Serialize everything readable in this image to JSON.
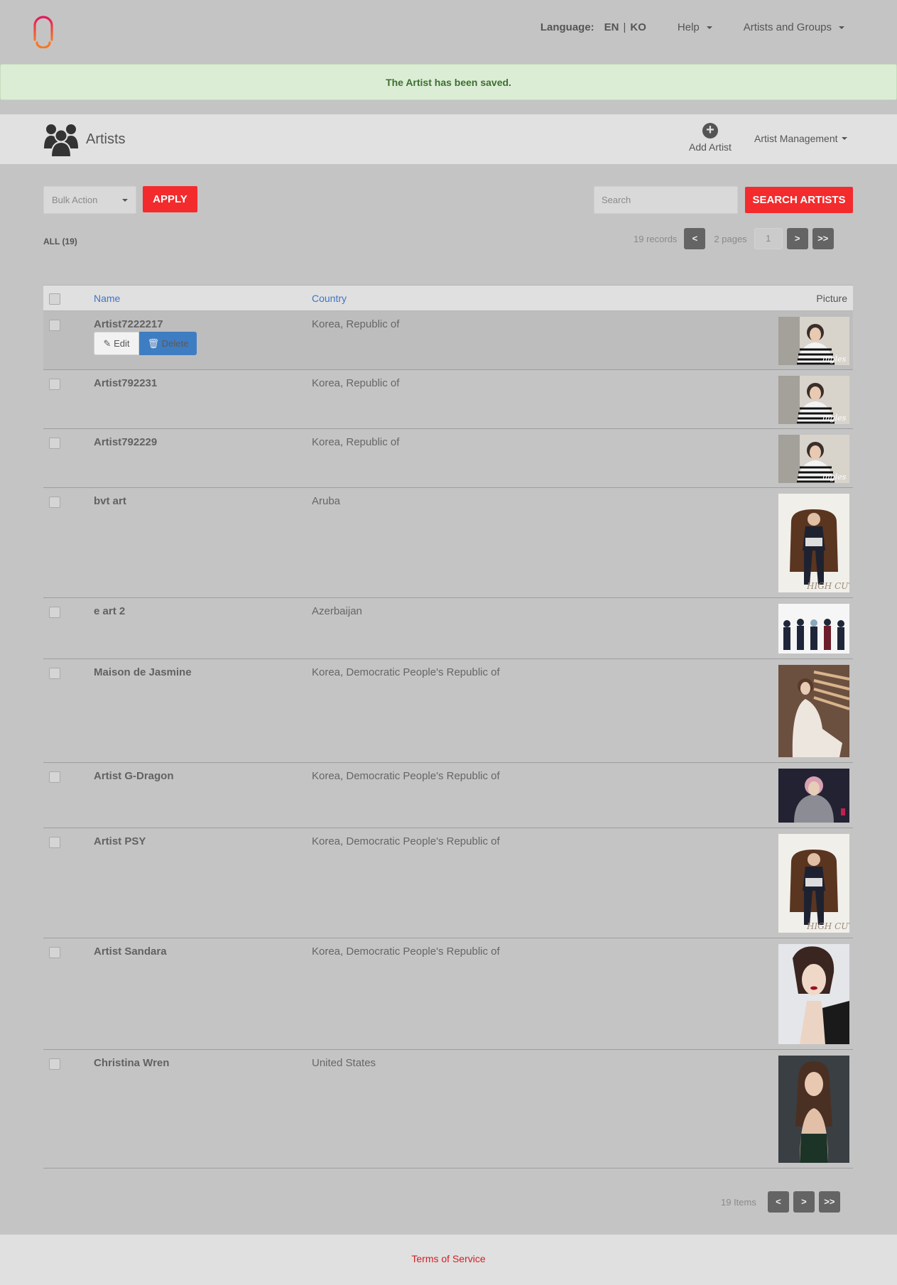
{
  "header": {
    "language_label": "Language:",
    "lang_en": "EN",
    "lang_sep": "|",
    "lang_ko": "KO",
    "help": "Help",
    "artists_groups": "Artists and Groups"
  },
  "alert": {
    "message": "The Artist has been saved."
  },
  "titlebar": {
    "title": "Artists",
    "add_artist": "Add Artist",
    "add_icon": "+",
    "artist_management": "Artist Management"
  },
  "controls": {
    "bulk_action": "Bulk Action",
    "apply": "APPLY",
    "search_placeholder": "Search",
    "search_button": "SEARCH ARTISTS",
    "all_count": "ALL (19)"
  },
  "pager_top": {
    "records": "19 records",
    "prev": "<",
    "pages": "2 pages",
    "page": "1",
    "next": ">",
    "last": ">>"
  },
  "table": {
    "columns": {
      "name": "Name",
      "country": "Country",
      "picture": "Picture"
    },
    "row_actions": {
      "edit": "Edit",
      "delete": "Delete"
    },
    "rows": [
      {
        "name": "Artist7222217",
        "country": "Korea, Republic of",
        "picture": "woman-striped-shirt"
      },
      {
        "name": "Artist792231",
        "country": "Korea, Republic of",
        "picture": "woman-striped-shirt"
      },
      {
        "name": "Artist792229",
        "country": "Korea, Republic of",
        "picture": "woman-striped-shirt"
      },
      {
        "name": "bvt art",
        "country": "Aruba",
        "picture": "man-in-armchair"
      },
      {
        "name": "e art 2",
        "country": "Azerbaijan",
        "picture": "group-of-five"
      },
      {
        "name": "Maison de Jasmine",
        "country": "Korea, Democratic People's Republic of",
        "picture": "woman-by-window"
      },
      {
        "name": "Artist G-Dragon",
        "country": "Korea, Democratic People's Republic of",
        "picture": "man-hoodie-pink-hair"
      },
      {
        "name": "Artist PSY",
        "country": "Korea, Democratic People's Republic of",
        "picture": "man-in-armchair"
      },
      {
        "name": "Artist Sandara",
        "country": "Korea, Democratic People's Republic of",
        "picture": "woman-portrait"
      },
      {
        "name": "Christina Wren",
        "country": "United States",
        "picture": "woman-dark-background"
      }
    ]
  },
  "pager_bottom": {
    "items": "19 Items",
    "prev": "<",
    "next": ">",
    "last": ">>"
  },
  "footer": {
    "terms": "Terms of Service"
  },
  "colors": {
    "accent_red": "#f32b2d",
    "link_blue": "#3f74c4",
    "alert_bg": "#dcedd6",
    "delete_blue": "#3f7dc2"
  }
}
